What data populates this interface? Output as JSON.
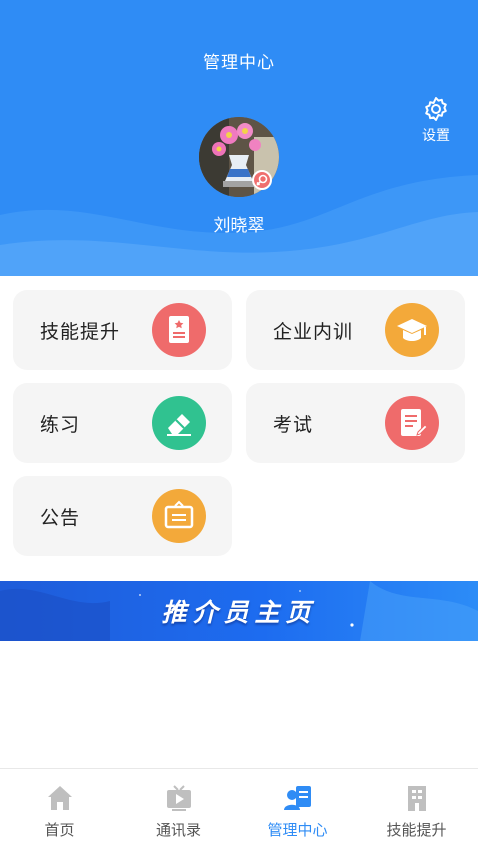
{
  "header": {
    "title": "管理中心",
    "settings_label": "设置",
    "user_name": "刘晓翠",
    "bg_color": "#2f8cf5"
  },
  "menu": [
    {
      "label": "技能提升",
      "icon": "certificate-icon",
      "color": "#ef6b6b"
    },
    {
      "label": "企业内训",
      "icon": "graduation-cap-icon",
      "color": "#f3a93a"
    },
    {
      "label": "练习",
      "icon": "eraser-icon",
      "color": "#30c290"
    },
    {
      "label": "考试",
      "icon": "exam-paper-icon",
      "color": "#ef6b6b"
    },
    {
      "label": "公告",
      "icon": "notice-board-icon",
      "color": "#f3a93a"
    }
  ],
  "banner": {
    "text": "推介员主页"
  },
  "bottom_nav": [
    {
      "label": "首页",
      "icon": "home-icon",
      "active": false
    },
    {
      "label": "通讯录",
      "icon": "tv-icon",
      "active": false
    },
    {
      "label": "管理中心",
      "icon": "management-icon",
      "active": true
    },
    {
      "label": "技能提升",
      "icon": "building-icon",
      "active": false
    }
  ],
  "colors": {
    "accent": "#2f8cf5",
    "inactive": "#555555",
    "card_bg": "#f5f5f5"
  }
}
